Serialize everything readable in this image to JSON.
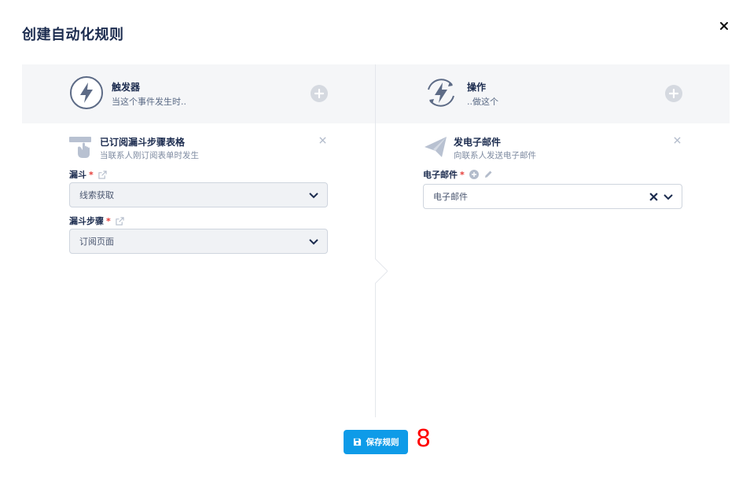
{
  "modal": {
    "title": "创建自动化规则",
    "close_icon": "close-icon"
  },
  "trigger": {
    "header_title": "触发器",
    "header_subtitle": "当这个事件发生时..",
    "header_icon": "lightning-bolt-icon",
    "add_icon": "plus-circle-icon",
    "card": {
      "icon": "funnel-form-hand-icon",
      "title": "已订阅漏斗步骤表格",
      "subtitle": "当联系人刚订阅表单时发生"
    },
    "fields": [
      {
        "label": "漏斗",
        "required_mark": "*",
        "value": "线索获取"
      },
      {
        "label": "漏斗步骤",
        "required_mark": "*",
        "value": "订阅页面"
      }
    ]
  },
  "action": {
    "header_title": "操作",
    "header_subtitle": "..做这个",
    "header_icon": "lightning-bolt-cycle-icon",
    "add_icon": "plus-circle-icon",
    "card": {
      "icon": "paper-plane-icon",
      "title": "发电子邮件",
      "subtitle": "向联系人发送电子邮件"
    },
    "fields": [
      {
        "label": "电子邮件",
        "required_mark": "*",
        "value": "电子邮件"
      }
    ]
  },
  "footer": {
    "save_label": "保存规则",
    "save_icon": "floppy-disk-icon"
  },
  "annotation": {
    "number": "8"
  },
  "colors": {
    "primary": "#0e9be8",
    "title": "#1c2c4f",
    "required": "#e53935",
    "header_bg": "#f5f6f8",
    "annotation": "#ff0000"
  }
}
